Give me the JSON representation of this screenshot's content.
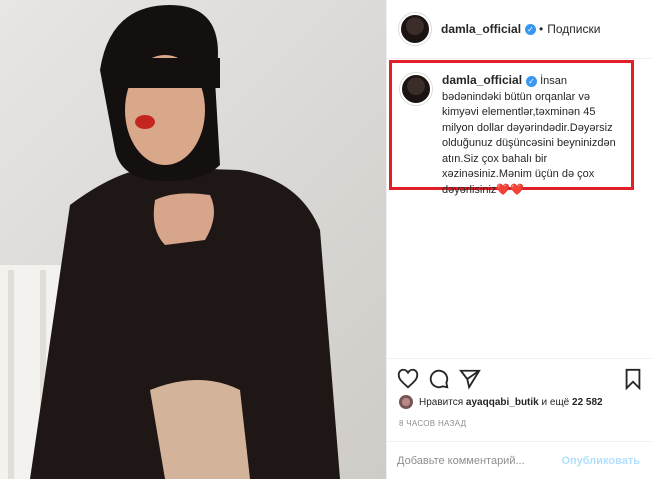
{
  "post": {
    "username": "damla_official",
    "follow_status": "Подписки",
    "caption": "İnsan bədənindəki bütün orqanlar və kimyəvi elementlər,təxminən 45 milyon dollar dəyərindədir.Dəyərsiz olduğunuz düşüncəsini beyninizdən atın.Siz çox bahalı bir xəzinəsiniz.Mənim üçün də çox dəyərlisiniz❤️❤️",
    "likes_prefix": "Нравится",
    "likes_user": "ayaqqabi_butik",
    "likes_and": "и ещё",
    "likes_count": "22 582",
    "timestamp": "8 ЧАСОВ НАЗАД",
    "comment_placeholder": "Добавьте комментарий...",
    "post_label": "Опубликовать"
  },
  "colors": {
    "verified": "#3897f0",
    "highlight_border": "#e11f26",
    "post_button": "#b2dffc"
  },
  "icons": [
    "heart-icon",
    "comment-icon",
    "share-icon",
    "bookmark-icon",
    "verified-icon"
  ]
}
